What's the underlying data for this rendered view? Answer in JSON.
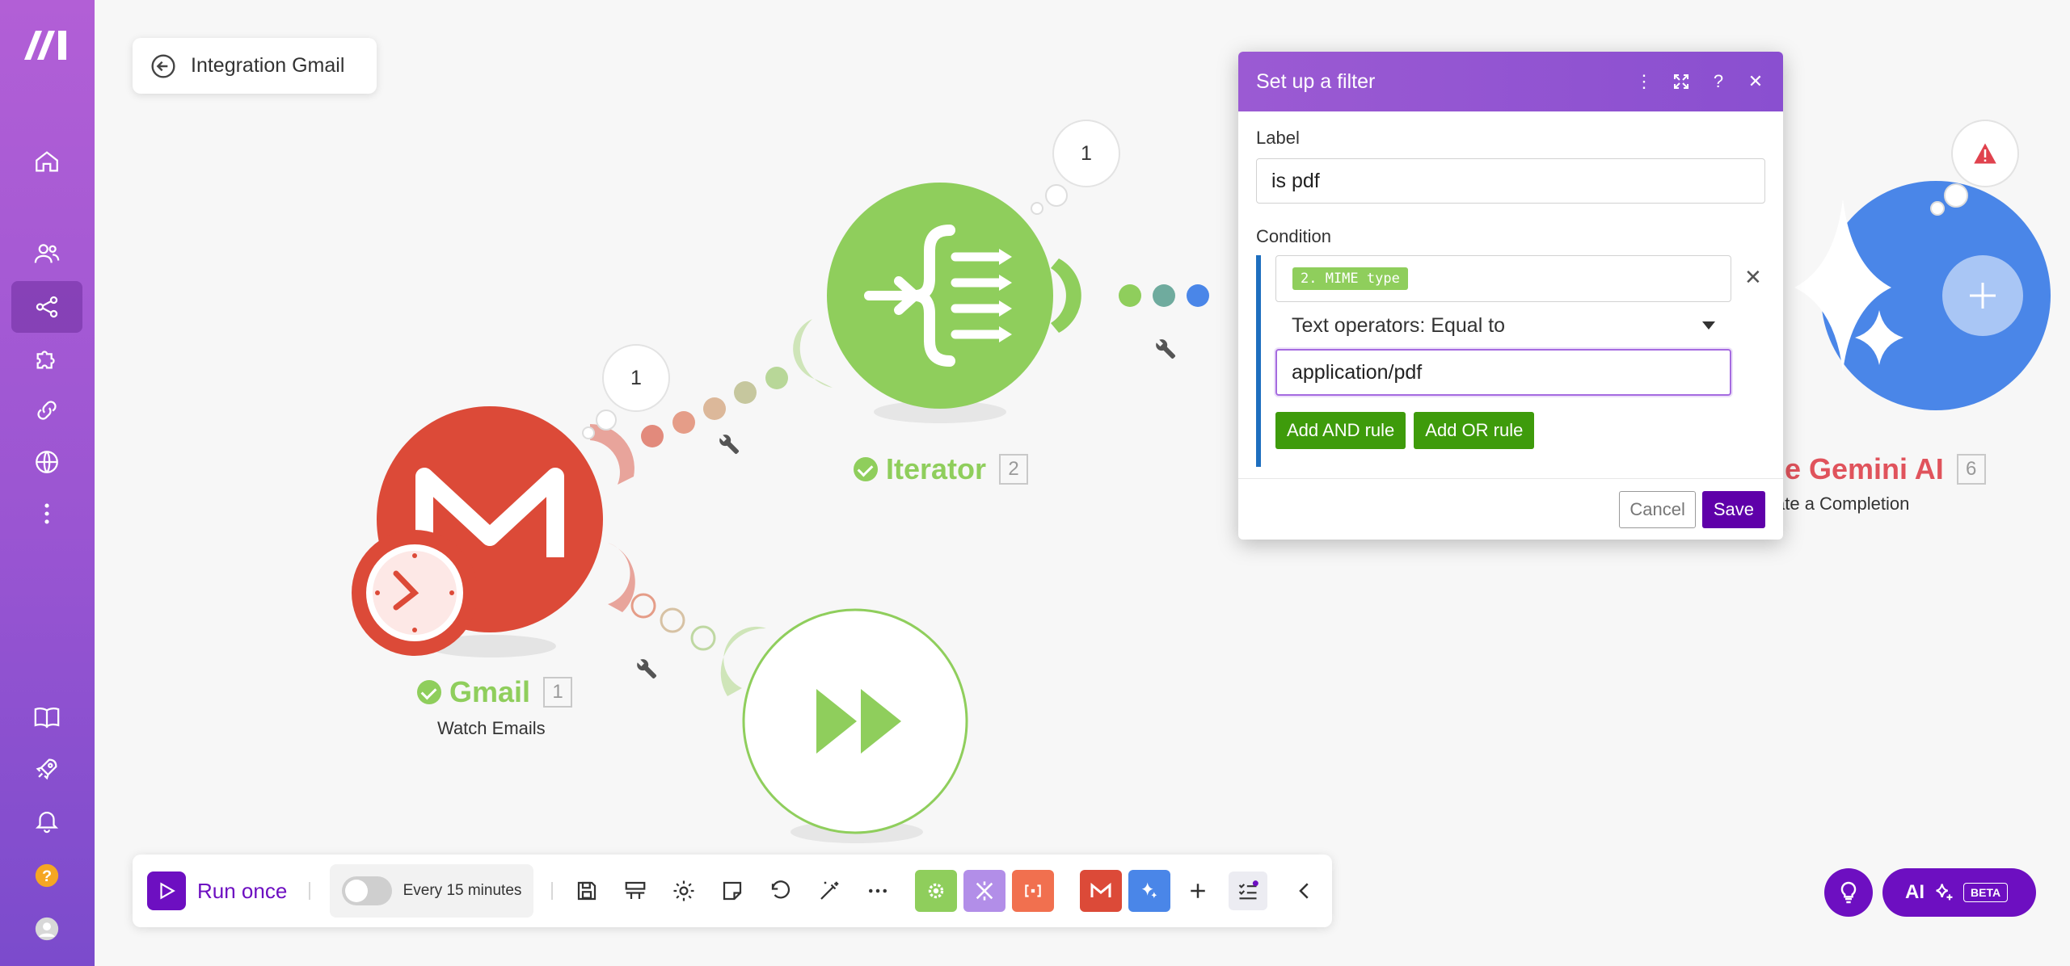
{
  "scenario": {
    "back_label": "Integration Gmail"
  },
  "nodes": {
    "gmail": {
      "name": "Gmail",
      "number": "1",
      "subtitle": "Watch Emails",
      "bubble": "1"
    },
    "iterator": {
      "name": "Iterator",
      "number": "2",
      "bubble": "1"
    },
    "gemini": {
      "name": "gle Gemini AI",
      "number": "6",
      "subtitle": "ate a Completion"
    }
  },
  "dialog": {
    "title": "Set up a filter",
    "label_caption": "Label",
    "label_value": "is pdf",
    "condition_caption": "Condition",
    "field_pill": "2. MIME type",
    "operator": "Text operators: Equal to",
    "value": "application/pdf",
    "add_and": "Add AND rule",
    "add_or": "Add OR rule",
    "cancel": "Cancel",
    "save": "Save"
  },
  "toolbar": {
    "run_once": "Run once",
    "schedule": "Every 15 minutes"
  },
  "ai": {
    "label": "AI",
    "badge": "BETA"
  },
  "colors": {
    "sidebar_top": "#b25fd6",
    "gmail_red": "#dc4a38",
    "iterator_green": "#8fce5c",
    "gemini_blue": "#4a86e8",
    "save_purple": "#5f00a9",
    "green_button": "#3e9b0b"
  }
}
